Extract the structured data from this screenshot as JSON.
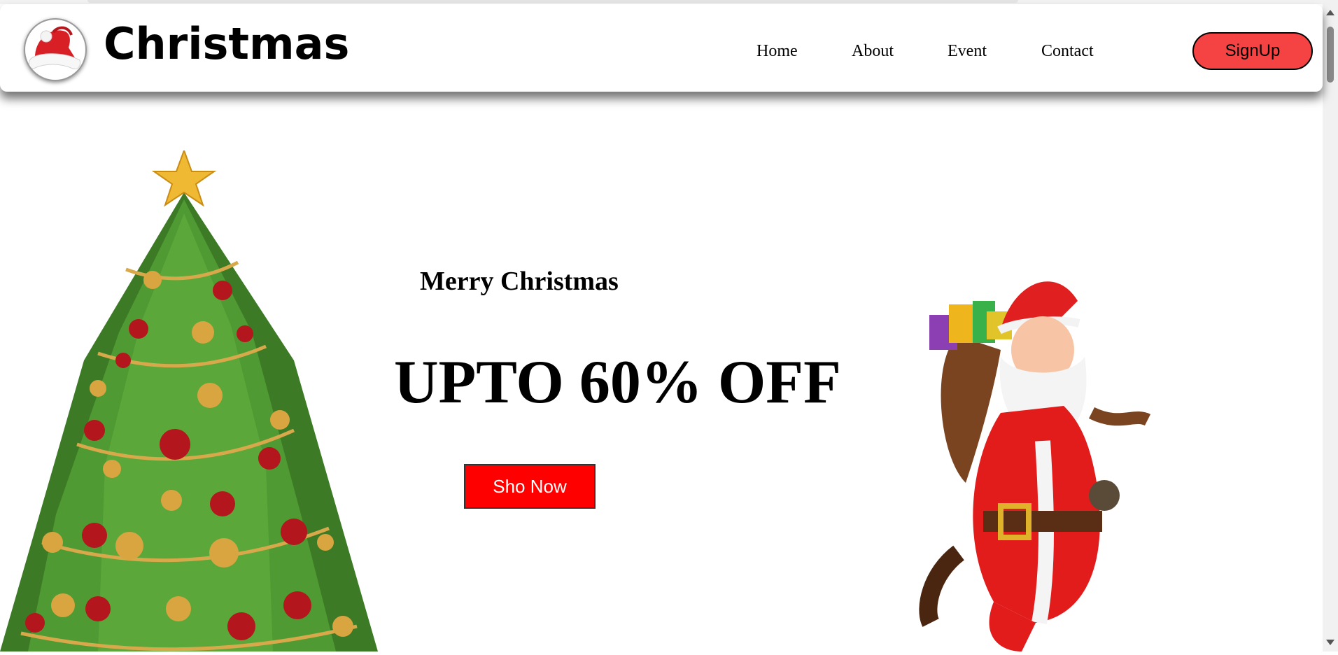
{
  "header": {
    "brand": "Christmas",
    "logo_icon": "santa-hat-icon",
    "nav": [
      {
        "label": "Home"
      },
      {
        "label": "About"
      },
      {
        "label": "Event"
      },
      {
        "label": "Contact"
      }
    ],
    "signup_label": "SignUp"
  },
  "hero": {
    "subtitle": "Merry Christmas",
    "headline": "UPTO 60% OFF",
    "cta_label": "Sho Now",
    "left_image": "christmas-tree-icon",
    "right_image": "santa-claus-icon"
  },
  "colors": {
    "accent_red": "#ff0000",
    "signup_red": "#f54343",
    "text": "#000000"
  }
}
